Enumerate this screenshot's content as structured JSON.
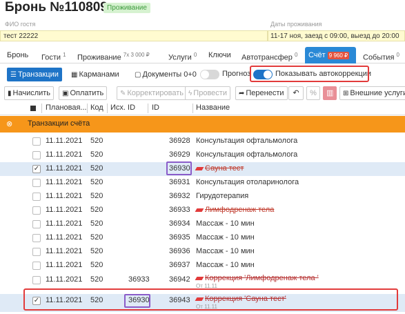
{
  "header": {
    "title": "Бронь №110809",
    "badge": "Проживание"
  },
  "guest": {
    "label": "ФИО гостя",
    "value": "тест 22222"
  },
  "dates": {
    "label": "Даты проживания",
    "value": "11-17 ноя, заезд с 09:00, выезд до 20:00"
  },
  "tabs": [
    {
      "label": "Бронь",
      "sup": ""
    },
    {
      "label": "Гости",
      "sup": "1"
    },
    {
      "label": "Проживание",
      "sup": "7х 3 000 ₽"
    },
    {
      "label": "Услуги",
      "sup": "0"
    },
    {
      "label": "Ключи",
      "sup": ""
    },
    {
      "label": "Автотрансфер",
      "sup": "0"
    },
    {
      "label": "Счёт",
      "sup": "9 960 ₽"
    },
    {
      "label": "События",
      "sup": "0"
    }
  ],
  "view_buttons": {
    "transactions": "Транзакции",
    "pockets": "Карманами",
    "documents": "Документы 0+0"
  },
  "toggles": {
    "forecast": {
      "label": "Прогноз",
      "on": false
    },
    "autocorr": {
      "label": "Показывать автокоррекции",
      "on": true
    }
  },
  "actions": {
    "charge": "Начислить",
    "pay": "Оплатить",
    "correct": "Корректировать",
    "post": "Провести",
    "transfer": "Перенести",
    "percent": "%",
    "external": "Внешние услуги"
  },
  "columns": {
    "date": "Плановая...",
    "code": "Код",
    "src": "Исх. ID",
    "id": "ID",
    "name": "Название"
  },
  "group": {
    "label": "Транзакции счёта"
  },
  "rows": [
    {
      "date": "11.11.2021",
      "code": "520",
      "src": "",
      "id": "36928",
      "name": "Консультация офтальмолога",
      "struck": false,
      "checked": false
    },
    {
      "date": "11.11.2021",
      "code": "520",
      "src": "",
      "id": "36929",
      "name": "Консультация офтальмолога",
      "struck": false,
      "checked": false
    },
    {
      "date": "11.11.2021",
      "code": "520",
      "src": "",
      "id": "36930",
      "name": "Сауна тест",
      "struck": true,
      "checked": true
    },
    {
      "date": "11.11.2021",
      "code": "520",
      "src": "",
      "id": "36931",
      "name": "Консультация отоларинолога",
      "struck": false,
      "checked": false
    },
    {
      "date": "11.11.2021",
      "code": "520",
      "src": "",
      "id": "36932",
      "name": "Гирудотерапия",
      "struck": false,
      "checked": false
    },
    {
      "date": "11.11.2021",
      "code": "520",
      "src": "",
      "id": "36933",
      "name": "Лимфодренаж тела",
      "struck": true,
      "checked": false
    },
    {
      "date": "11.11.2021",
      "code": "520",
      "src": "",
      "id": "36934",
      "name": "Массаж - 10 мин",
      "struck": false,
      "checked": false
    },
    {
      "date": "11.11.2021",
      "code": "520",
      "src": "",
      "id": "36935",
      "name": "Массаж - 10 мин",
      "struck": false,
      "checked": false
    },
    {
      "date": "11.11.2021",
      "code": "520",
      "src": "",
      "id": "36936",
      "name": "Массаж - 10 мин",
      "struck": false,
      "checked": false
    },
    {
      "date": "11.11.2021",
      "code": "520",
      "src": "",
      "id": "36937",
      "name": "Массаж - 10 мин",
      "struck": false,
      "checked": false
    },
    {
      "date": "11.11.2021",
      "code": "520",
      "src": "36933",
      "id": "36942",
      "name": "Коррекция 'Лимфодренаж тела '",
      "struck": true,
      "checked": false,
      "sub": "От 11.11"
    },
    {
      "date": "11.11.2021",
      "code": "520",
      "src": "36930",
      "id": "36943",
      "name": "Коррекция 'Сауна тест'",
      "struck": true,
      "checked": true,
      "sub": "От 11.11"
    }
  ]
}
